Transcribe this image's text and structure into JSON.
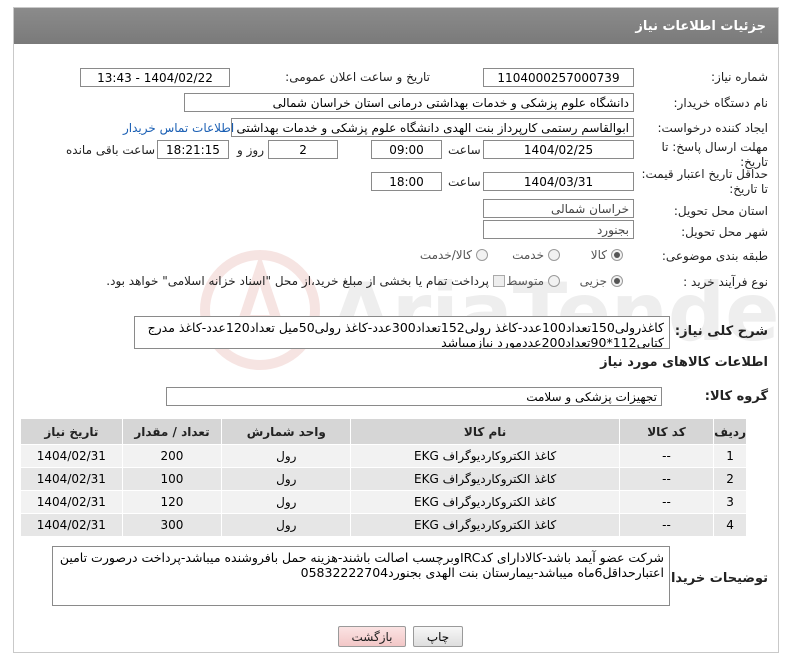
{
  "header": {
    "title": "جزئیات اطلاعات نیاز"
  },
  "fields": {
    "need_number_label": "شماره نیاز:",
    "need_number": "1104000257000739",
    "announce_label": "تاریخ و ساعت اعلان عمومی:",
    "announce_value": "1404/02/22 - 13:43",
    "buyer_org_label": "نام دستگاه خریدار:",
    "buyer_org": "دانشگاه علوم پزشکی و خدمات بهداشتی درمانی استان خراسان شمالی",
    "creator_label": "ایجاد کننده درخواست:",
    "creator": "ابوالقاسم رستمی کارپرداز بنت الهدی دانشگاه علوم پزشکی و خدمات بهداشتی",
    "contact_link": "اطلاعات تماس خریدار",
    "deadline_label_1": "مهلت ارسال پاسخ: تا",
    "deadline_label_2": "تاریخ:",
    "deadline_date": "1404/02/25",
    "time_label": "ساعت",
    "deadline_time": "09:00",
    "days_value": "2",
    "days_label": "روز و",
    "remaining_time": "18:21:15",
    "remaining_label": "ساعت باقی مانده",
    "validity_label_1": "حداقل تاریخ اعتبار قیمت:",
    "validity_label_2": "تا تاریخ:",
    "validity_date": "1404/03/31",
    "validity_time": "18:00",
    "province_label": "استان محل تحویل:",
    "province": "خراسان شمالی",
    "city_label": "شهر محل تحویل:",
    "city": "بجنورد",
    "category_label": "طبقه بندی موضوعی:",
    "category_options": [
      "کالا",
      "خدمت",
      "کالا/خدمت"
    ],
    "process_label": "نوع فرآیند خرید :",
    "process_options": [
      "جزیی",
      "متوسط"
    ],
    "payment_note": "پرداخت تمام یا بخشی از مبلغ خرید،از محل \"اسناد خزانه اسلامی\" خواهد بود.",
    "general_desc_label": "شرح کلی نیاز:",
    "general_desc": "کاغذرولی150تعداد100عدد-کاغذ رولی152تعداد300عدد-کاغذ رولی50میل تعداد120عدد-کاغذ مدرج کتابی112*90تعداد200عددمورد نیازمیباشد",
    "goods_info_title": "اطلاعات کالاهای مورد نیاز",
    "goods_group_label": "گروه کالا:",
    "goods_group": "تجهیزات پزشکی و سلامت",
    "buyer_notes_label": "توضیحات خریدار:",
    "buyer_notes": "شرکت عضو آیمد باشد-کالادارای کدIRCوبرچسب اصالت باشند-هزینه حمل بافروشنده میباشد-پرداخت درصورت تامین اعتبارحداقل6ماه میباشد-بیمارستان بنت الهدی بجنورد05832222704"
  },
  "table": {
    "headers": [
      "ردیف",
      "کد کالا",
      "نام کالا",
      "واحد شمارش",
      "تعداد / مقدار",
      "تاریخ نیاز"
    ],
    "rows": [
      [
        "1",
        "--",
        "کاغذ الکتروکاردیوگراف EKG",
        "رول",
        "200",
        "1404/02/31"
      ],
      [
        "2",
        "--",
        "کاغذ الکتروکاردیوگراف EKG",
        "رول",
        "100",
        "1404/02/31"
      ],
      [
        "3",
        "--",
        "کاغذ الکتروکاردیوگراف EKG",
        "رول",
        "120",
        "1404/02/31"
      ],
      [
        "4",
        "--",
        "کاغذ الکتروکاردیوگراف EKG",
        "رول",
        "300",
        "1404/02/31"
      ]
    ]
  },
  "buttons": {
    "print": "چاپ",
    "back": "بازگشت"
  },
  "watermark": "AriaTender.neT"
}
